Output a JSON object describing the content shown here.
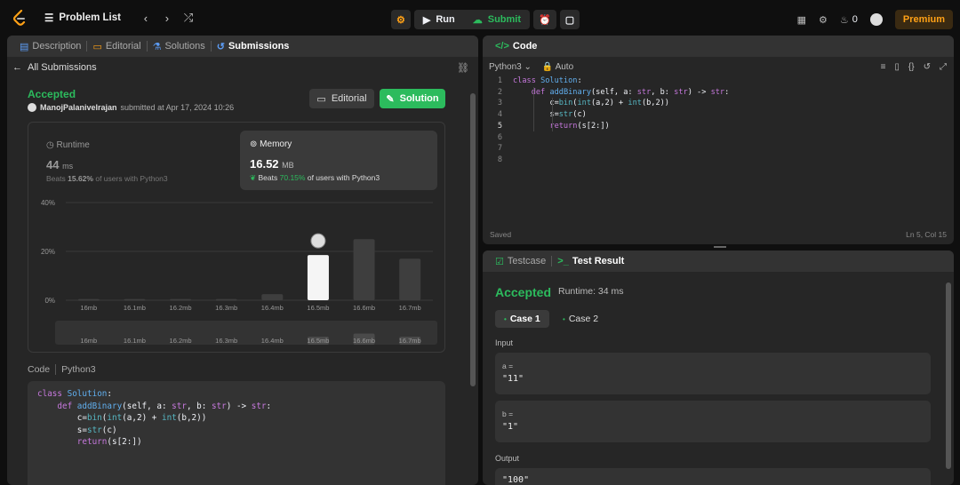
{
  "topbar": {
    "problem_list": "Problem List",
    "run": "Run",
    "submit": "Submit",
    "streak": "0",
    "premium": "Premium"
  },
  "left_tabs": [
    {
      "label": "Description"
    },
    {
      "label": "Editorial"
    },
    {
      "label": "Solutions"
    },
    {
      "label": "Submissions"
    }
  ],
  "submission": {
    "back_label": "All Submissions",
    "status": "Accepted",
    "user": "ManojPalanivelrajan",
    "submitted_text": "submitted at Apr 17, 2024 10:26",
    "editorial_btn": "Editorial",
    "solution_btn": "Solution"
  },
  "runtime": {
    "title": "Runtime",
    "value": "44",
    "unit": "ms",
    "beats_prefix": "Beats",
    "beats_pct": "15.62%",
    "beats_suffix": "of users with Python3"
  },
  "memory": {
    "title": "Memory",
    "value": "16.52",
    "unit": "MB",
    "beats_prefix": "Beats",
    "beats_pct": "70.15%",
    "beats_suffix": "of users with Python3"
  },
  "chart_data": {
    "type": "bar",
    "categories": [
      "16mb",
      "16.1mb",
      "16.2mb",
      "16.3mb",
      "16.4mb",
      "16.5mb",
      "16.6mb",
      "16.7mb"
    ],
    "values": [
      0.5,
      0.5,
      0.5,
      0.5,
      2.5,
      18.5,
      25,
      17
    ],
    "highlight_index": 5,
    "y_ticks": [
      "40%",
      "20%",
      "0%"
    ],
    "ylim": [
      0,
      40
    ],
    "overview_values": [
      0,
      0,
      0,
      0,
      0,
      1,
      1.5,
      1
    ],
    "colors": {
      "bar": "#3e3e3e",
      "highlight": "#f5f5f5",
      "grid": "#3a3a3a"
    }
  },
  "code_section": {
    "label": "Code",
    "lang": "Python3"
  },
  "code_lines": [
    "class Solution:",
    "    def addBinary(self, a: str, b: str) -> str:",
    "        c=bin(int(a,2) + int(b,2))",
    "        s=str(c)",
    "        return(s[2:])"
  ],
  "editor": {
    "title": "Code",
    "language": "Python3",
    "mode": "Auto",
    "line_numbers": [
      "1",
      "2",
      "3",
      "4",
      "5",
      "6",
      "7",
      "8"
    ],
    "saved": "Saved",
    "cursor": "Ln 5, Col 15"
  },
  "result": {
    "tab_testcase": "Testcase",
    "tab_result": "Test Result",
    "status": "Accepted",
    "runtime": "Runtime: 34 ms",
    "case1": "Case 1",
    "case2": "Case 2",
    "input_label": "Input",
    "a_name": "a =",
    "a_value": "\"11\"",
    "b_name": "b =",
    "b_value": "\"1\"",
    "output_label": "Output",
    "output_value": "\"100\""
  }
}
